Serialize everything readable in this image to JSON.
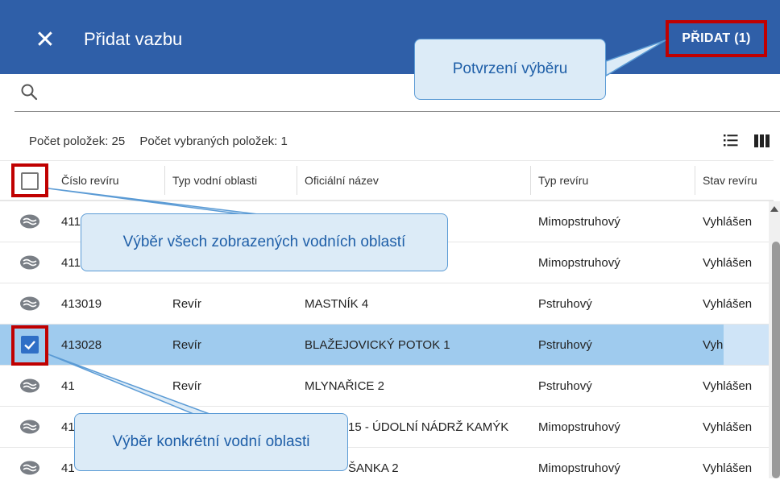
{
  "dialog": {
    "title": "Přidat vazbu",
    "add_button_label": "PŘIDAT (1)"
  },
  "search": {
    "placeholder": ""
  },
  "summary": {
    "count_label": "Počet položek: 25",
    "selected_label": "Počet vybraných položek: 1"
  },
  "table": {
    "columns": [
      "Číslo revíru",
      "Typ vodní oblasti",
      "Oficiální název",
      "Typ revíru",
      "Stav revíru"
    ],
    "rows": [
      {
        "cislo": "411",
        "typ_oblasti": "",
        "nazev": "",
        "typ_reviru": "Mimopstruhový",
        "stav": "Vyhlášen",
        "selected": false
      },
      {
        "cislo": "411",
        "typ_oblasti": "",
        "nazev": "",
        "typ_reviru": "Mimopstruhový",
        "stav": "Vyhlášen",
        "selected": false
      },
      {
        "cislo": "413019",
        "typ_oblasti": "Revír",
        "nazev": "MASTNÍK 4",
        "typ_reviru": "Pstruhový",
        "stav": "Vyhlášen",
        "selected": false
      },
      {
        "cislo": "413028",
        "typ_oblasti": "Revír",
        "nazev": "BLAŽEJOVICKÝ POTOK 1",
        "typ_reviru": "Pstruhový",
        "stav": "Vyh",
        "selected": true
      },
      {
        "cislo": "41",
        "typ_oblasti": "Revír",
        "nazev": "MLYNAŘICE 2",
        "typ_reviru": "Pstruhový",
        "stav": "Vyhlášen",
        "selected": false
      },
      {
        "cislo": "41",
        "typ_oblasti": "",
        "nazev": "15 - ÚDOLNÍ NÁDRŽ KAMÝK",
        "typ_reviru": "Mimopstruhový",
        "stav": "Vyhlášen",
        "selected": false
      },
      {
        "cislo": "41",
        "typ_oblasti": "",
        "nazev": "ŠANKA 2",
        "typ_reviru": "Mimopstruhový",
        "stav": "Vyhlášen",
        "selected": false
      }
    ]
  },
  "callouts": {
    "confirm": "Potvrzení výběru",
    "select_all": "Výběr všech zobrazených vodních oblastí",
    "select_one": "Výběr konkrétní vodní oblasti"
  },
  "colors": {
    "header": "#2f5fa8",
    "highlight": "#c00000",
    "selected_row": "#9fcbee",
    "callout_fill": "#dcebf7",
    "callout_text": "#1f5fa8"
  },
  "icons": {
    "close": "close-icon",
    "search": "search-icon",
    "list_view": "list-view-icon",
    "column_view": "column-view-icon",
    "row_type": "water-area-icon"
  }
}
